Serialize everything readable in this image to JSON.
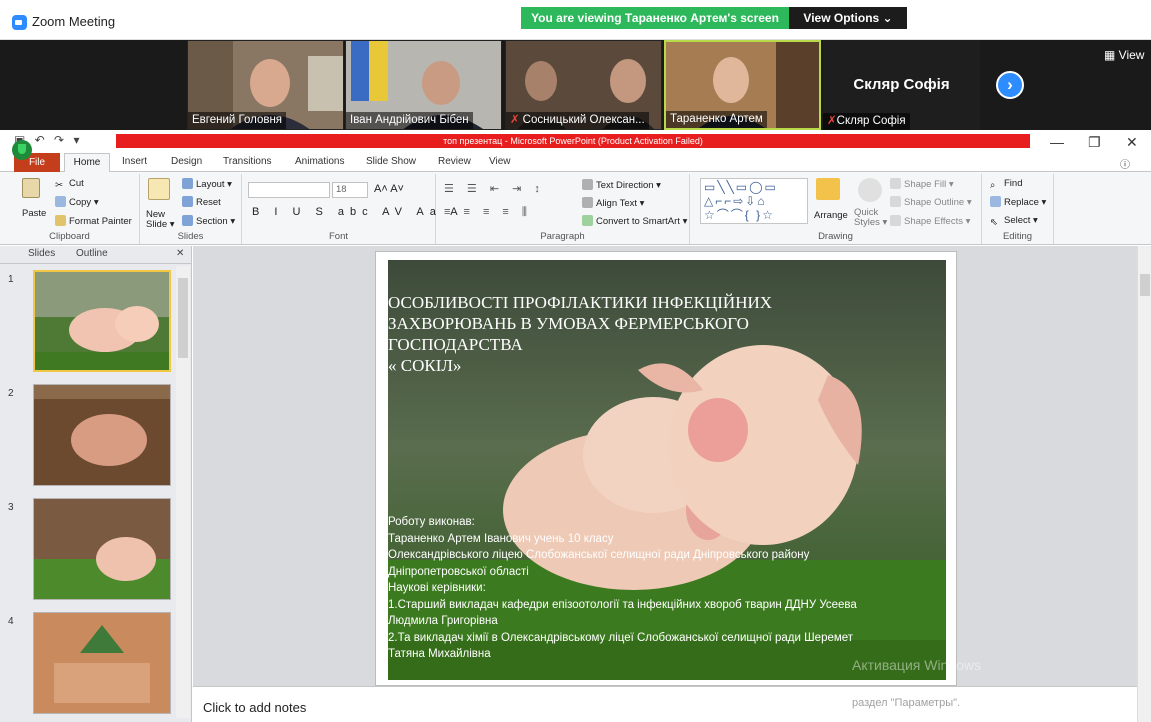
{
  "zoom": {
    "window_title": "Zoom Meeting",
    "viewing_banner": "You are viewing Тараненко Артем's screen",
    "view_options": "View Options ⌄",
    "view_button": "View",
    "participants": [
      {
        "name": "Евгений Головня"
      },
      {
        "name": "Іван Андрійович Бібен"
      },
      {
        "name": "Сосницький Олексан..."
      },
      {
        "name": "Тараненко Артем"
      }
    ],
    "name_only_tile": {
      "display": "Скляр Софія",
      "caption": "Скляр Софія"
    }
  },
  "ppt": {
    "title": "топ презентац  -  Microsoft PowerPoint (Product Activation Failed)",
    "tabs": [
      "File",
      "Home",
      "Insert",
      "Design",
      "Transitions",
      "Animations",
      "Slide Show",
      "Review",
      "View"
    ],
    "clipboard": {
      "cut": "Cut",
      "copy": "Copy ▾",
      "paste": "Paste",
      "format_painter": "Format Painter",
      "label": "Clipboard"
    },
    "slides_group": {
      "new_slide": "New Slide ▾",
      "layout": "Layout ▾",
      "reset": "Reset",
      "section": "Section ▾",
      "label": "Slides"
    },
    "font_group": {
      "size": "18",
      "label": "Font"
    },
    "paragraph_group": {
      "text_direction": "Text Direction ▾",
      "align_text": "Align Text ▾",
      "convert": "Convert to SmartArt ▾",
      "label": "Paragraph"
    },
    "drawing_group": {
      "arrange": "Arrange",
      "quick_styles": "Quick Styles ▾",
      "shape_fill": "Shape Fill ▾",
      "shape_outline": "Shape Outline ▾",
      "shape_effects": "Shape Effects ▾",
      "label": "Drawing"
    },
    "editing_group": {
      "find": "Find",
      "replace": "Replace ▾",
      "select": "Select ▾",
      "label": "Editing"
    },
    "pane_tabs": {
      "slides": "Slides",
      "outline": "Outline"
    },
    "slide_numbers": [
      "1",
      "2",
      "3",
      "4"
    ],
    "slide": {
      "title_lines": [
        "ОСОБЛИВОСТІ ПРОФІЛАКТИКИ ІНФЕКЦІЙНИХ",
        "ЗАХВОРЮВАНЬ В УМОВАХ  ФЕРМЕРСЬКОГО",
        "ГОСПОДАРСТВА",
        "« СОКІЛ»"
      ],
      "body_lines": [
        "Роботу виконав:",
        "Тараненко Артем Іванович учень 10 класу",
        "Олександрівського ліцею Слобожанської селищної ради Дніпровського району",
        "Дніпропетровської області",
        "Наукові керівники:",
        "1.Старший викладач кафедри епізоотології та інфекційних хвороб тварин ДДНУ Усеева",
        "Людмила Григорівна",
        "2.Та викладач хімії в Олександрівському ліцеї Слобожанської селищної ради Шеремет",
        "Татяна Михайлівна"
      ]
    },
    "notes_placeholder": "Click to add notes",
    "activation": {
      "line1": "Активация Windows",
      "line2": "раздел \"Параметры\"."
    }
  }
}
